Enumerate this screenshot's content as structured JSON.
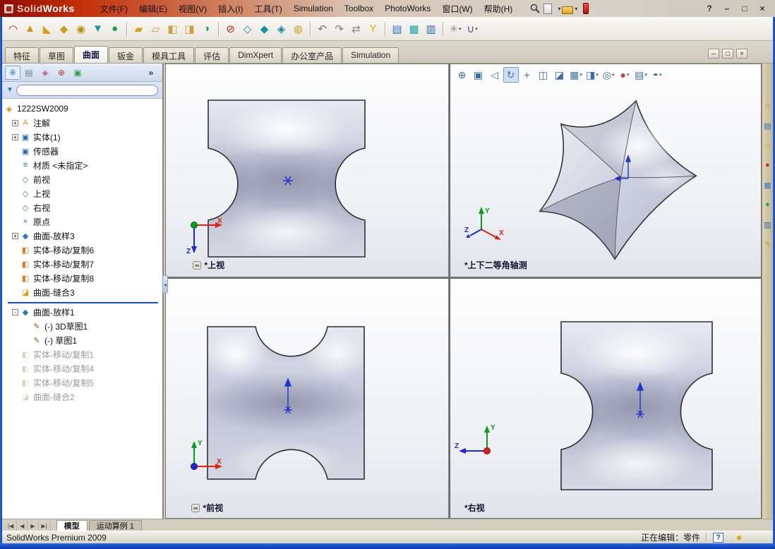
{
  "titlebar": {
    "brand": {
      "part1": "Solid",
      "part2": "Works"
    },
    "menus": [
      {
        "n": "menu-file",
        "lab": "文件(F)"
      },
      {
        "n": "menu-edit",
        "lab": "编辑(E)"
      },
      {
        "n": "menu-view",
        "lab": "视图(V)"
      },
      {
        "n": "menu-insert",
        "lab": "插入(I)"
      },
      {
        "n": "menu-tools",
        "lab": "工具(T)"
      },
      {
        "n": "menu-simulation",
        "lab": "Simulation"
      },
      {
        "n": "menu-toolbox",
        "lab": "Toolbox"
      },
      {
        "n": "menu-photoworks",
        "lab": "PhotoWorks"
      },
      {
        "n": "menu-window",
        "lab": "窗口(W)"
      },
      {
        "n": "menu-help",
        "lab": "帮助(H)"
      }
    ],
    "quick_caret": "▾",
    "window_controls": [
      {
        "n": "help-button",
        "g": "?"
      },
      {
        "n": "minimize-button",
        "g": "–"
      },
      {
        "n": "restore-button",
        "g": "□"
      },
      {
        "n": "close-button",
        "g": "×"
      }
    ]
  },
  "toolbar": {
    "icons": [
      {
        "n": "swept-surface-icon",
        "g": "◠",
        "ist": "color:#c43010"
      },
      {
        "n": "extruded-surface-icon",
        "g": "▲",
        "ist": "color:#d89010"
      },
      {
        "n": "revolved-surface-icon",
        "g": "◣",
        "ist": "color:#d8a010"
      },
      {
        "n": "lofted-surface-icon",
        "g": "◆",
        "ist": "color:#c8a020"
      },
      {
        "n": "boundary-surface-icon",
        "g": "◉",
        "ist": "color:#b89010"
      },
      {
        "n": "offset-surface-icon",
        "g": "▼",
        "ist": "color:#1898a0"
      },
      {
        "n": "radiate-surface-icon",
        "g": "●",
        "ist": "color:#18a048"
      },
      {
        "n": "toolbar-separator",
        "cls": "tbi tsep",
        "it": "false"
      },
      {
        "n": "filled-surface-icon",
        "g": "▰",
        "ist": "color:#d4a017"
      },
      {
        "n": "planar-surface-icon",
        "g": "▱",
        "ist": "color:#c8a040"
      },
      {
        "n": "extend-surface-icon",
        "g": "◧",
        "ist": "color:#caa040"
      },
      {
        "n": "trim-surface-icon",
        "g": "◨",
        "ist": "color:#caa040"
      },
      {
        "n": "knit-surface-icon",
        "g": "◑",
        "ist": "color:#20a060"
      },
      {
        "n": "toolbar-separator",
        "cls": "tbi tsep",
        "it": "false"
      },
      {
        "n": "delete-face-icon",
        "g": "⊘",
        "ist": "color:#c02020"
      },
      {
        "n": "replace-face-icon",
        "g": "◇",
        "ist": "color:#1890a8"
      },
      {
        "n": "untrim-surface-icon",
        "g": "◆",
        "ist": "color:#1890a8"
      },
      {
        "n": "thicken-icon",
        "g": "◈",
        "ist": "color:#16889c"
      },
      {
        "n": "freeform-icon",
        "g": "◍",
        "ist": "color:#d0a018"
      },
      {
        "n": "toolbar-separator",
        "cls": "tbi tsep",
        "it": "false"
      },
      {
        "n": "undo-icon",
        "g": "↶",
        "ist": "color:#787878"
      },
      {
        "n": "redo-icon",
        "g": "↷",
        "ist": "color:#787878"
      },
      {
        "n": "rebuild-icon",
        "g": "⇄",
        "ist": "color:#888888"
      },
      {
        "n": "mirror-icon",
        "g": "Y",
        "ist": "color:#d4b000"
      },
      {
        "n": "toolbar-separator",
        "cls": "tbi tsep",
        "it": "false"
      },
      {
        "n": "reference-geometry-icon",
        "g": "▤",
        "ist": "color:#3070c0"
      },
      {
        "n": "curves-icon",
        "g": "▦",
        "ist": "color:#18a0a8"
      },
      {
        "n": "instant3d-icon",
        "g": "▥",
        "ist": "color:#2868b8"
      },
      {
        "n": "toolbar-separator",
        "cls": "tbi tsep",
        "it": "false"
      },
      {
        "n": "sketch-tools-icon",
        "g": "✳",
        "ist": "color:#9090a0",
        "c": "▾"
      },
      {
        "n": "spline-tools-icon",
        "g": "∪",
        "ist": "color:#7040a0",
        "c": "▾"
      }
    ]
  },
  "commandmanager": {
    "tabs": [
      {
        "n": "tab-features",
        "lab": "特征"
      },
      {
        "n": "tab-sketch",
        "lab": "草图"
      },
      {
        "n": "tab-surfaces",
        "lab": "曲面",
        "cls": "ctab active"
      },
      {
        "n": "tab-sheet-metal",
        "lab": "钣金"
      },
      {
        "n": "tab-mold-tools",
        "lab": "模具工具"
      },
      {
        "n": "tab-evaluate",
        "lab": "评估"
      },
      {
        "n": "tab-dimxpert",
        "lab": "DimXpert"
      },
      {
        "n": "tab-office-products",
        "lab": "办公室产品"
      },
      {
        "n": "tab-simulation",
        "lab": "Simulation"
      }
    ],
    "pane_controls": [
      {
        "n": "doc-minimize-button",
        "g": "–"
      },
      {
        "n": "doc-restore-button",
        "g": "□"
      },
      {
        "n": "doc-close-button",
        "g": "×"
      }
    ]
  },
  "panel": {
    "manager_tabs": [
      {
        "n": "featuremanager-tab-icon",
        "g": "※",
        "ist": "color:#2878c8",
        "cls": "mti active"
      },
      {
        "n": "propertymanager-tab-icon",
        "g": "▤",
        "ist": "color:#708090"
      },
      {
        "n": "configurationmanager-tab-icon",
        "g": "◈",
        "ist": "color:#c05890"
      },
      {
        "n": "dimxpertmanager-tab-icon",
        "g": "⊕",
        "ist": "color:#c03030"
      },
      {
        "n": "displaymanager-tab-icon",
        "g": "▣",
        "ist": "color:#30a050"
      },
      {
        "n": "panel-overflow-icon",
        "g": "»",
        "cls": "mti overflow"
      }
    ],
    "filter_glyph": "▼"
  },
  "tree": {
    "items": [
      {
        "n": "tree-root-part",
        "cls": "trow root",
        "g": "◈",
        "ist": "color:#c89010",
        "lab": "1222SW2009"
      },
      {
        "n": "tree-item-annotations",
        "exp": "+",
        "g": "A",
        "ist": "color:#c8980c",
        "lab": "注解"
      },
      {
        "n": "tree-item-solid-bodies",
        "exp": "+",
        "g": "▣",
        "ist": "color:#2468b0",
        "lab": "实体(1)"
      },
      {
        "n": "tree-item-sensors",
        "g": "▣",
        "ist": "color:#2468b0",
        "lab": "传感器"
      },
      {
        "n": "tree-item-material",
        "g": "≡",
        "ist": "color:#3060c0",
        "lab": "材质 <未指定>"
      },
      {
        "n": "tree-item-front-plane",
        "g": "◇",
        "ist": "color:#3878b8",
        "lab": "前视"
      },
      {
        "n": "tree-item-top-plane",
        "g": "◇",
        "ist": "color:#3878b8",
        "lab": "上视"
      },
      {
        "n": "tree-item-right-plane",
        "g": "◇",
        "ist": "color:#3878b8",
        "lab": "右视"
      },
      {
        "n": "tree-item-origin",
        "g": "⌖",
        "ist": "color:#3878b8",
        "lab": "原点"
      },
      {
        "n": "tree-item-surface-loft3",
        "exp": "+",
        "g": "◆",
        "ist": "color:#2878c0",
        "lab": "曲面-放样3"
      },
      {
        "n": "tree-item-body-move-copy6",
        "g": "◧",
        "ist": "color:#e07820",
        "lab": "实体-移动/复制6"
      },
      {
        "n": "tree-item-body-move-copy7",
        "g": "◧",
        "ist": "color:#e07820",
        "lab": "实体-移动/复制7"
      },
      {
        "n": "tree-item-body-move-copy8",
        "g": "◧",
        "ist": "color:#e07820",
        "lab": "实体-移动/复制8"
      },
      {
        "n": "tree-item-surface-knit3",
        "g": "◪",
        "ist": "color:#d8a010",
        "lab": "曲面-缝合3"
      },
      {
        "n": "rollback-bar",
        "cls": "trow rollback"
      },
      {
        "n": "tree-item-surface-loft1",
        "exp": "-",
        "g": "◆",
        "ist": "color:#2878c0",
        "lab": "曲面-放样1"
      },
      {
        "n": "tree-item-3d-sketch1",
        "st": "padding-left:30px",
        "g": "✎",
        "ist": "color:#806020",
        "lab": "(-) 3D草图1"
      },
      {
        "n": "tree-item-sketch1",
        "st": "padding-left:30px",
        "g": "✎",
        "ist": "color:#806020",
        "lab": "(-) 草图1"
      },
      {
        "n": "tree-item-body-move-copy1",
        "cls": "trow gray",
        "g": "◧",
        "ist": "color:#c0a888",
        "lab": "实体-移动/复制1"
      },
      {
        "n": "tree-item-body-move-copy4",
        "cls": "trow gray",
        "g": "◧",
        "ist": "color:#c0a888",
        "lab": "实体-移动/复制4"
      },
      {
        "n": "tree-item-body-move-copy5",
        "cls": "trow gray",
        "g": "◧",
        "ist": "color:#c0a888",
        "lab": "实体-移动/复制5"
      },
      {
        "n": "tree-item-surface-knit2",
        "cls": "trow gray",
        "g": "◪",
        "ist": "color:#c4b488",
        "lab": "曲面-缝合2"
      }
    ]
  },
  "graphics": {
    "splitter_glyph": "◂"
  },
  "headsup": {
    "icons": [
      {
        "n": "zoom-to-fit-icon",
        "g": "⊕"
      },
      {
        "n": "zoom-to-area-icon",
        "g": "▣"
      },
      {
        "n": "previous-view-icon",
        "g": "◁"
      },
      {
        "n": "rotate-view-icon",
        "g": "↻",
        "cls": "hui active"
      },
      {
        "n": "pan-icon",
        "g": "+"
      },
      {
        "n": "3d-drawing-view-icon",
        "g": "◫"
      },
      {
        "n": "section-view-icon",
        "g": "◪"
      },
      {
        "n": "view-orientation-icon",
        "g": "▦",
        "c": "▾"
      },
      {
        "n": "display-style-icon",
        "g": "◨",
        "c": "▾"
      },
      {
        "n": "hide-show-items-icon",
        "g": "◎",
        "c": "▾"
      },
      {
        "n": "edit-appearance-icon",
        "g": "●",
        "ist": "color:#c84040",
        "c": "▾"
      },
      {
        "n": "apply-scene-icon",
        "g": "▤",
        "c": "▾"
      },
      {
        "n": "view-settings-icon",
        "g": "◓",
        "c": "▾"
      }
    ]
  },
  "viewports": {
    "top": {
      "label": "*上视",
      "icon": "∞"
    },
    "iso": {
      "label": "*上下二等角轴测"
    },
    "front": {
      "label": "*前视",
      "icon": "∞"
    },
    "right": {
      "label": "*右视"
    }
  },
  "taskpane": {
    "icons": [
      {
        "n": "solidworks-resources-icon",
        "g": "⌂",
        "ist": "color:#c87818"
      },
      {
        "n": "design-library-icon",
        "g": "▤",
        "ist": "color:#2868b8"
      },
      {
        "n": "file-explorer-icon",
        "g": "▱",
        "ist": "color:#e0a818"
      },
      {
        "n": "solidworks-search-icon",
        "g": "●",
        "ist": "color:#c03030"
      },
      {
        "n": "view-palette-icon",
        "g": "▦",
        "ist": "color:#3878c8"
      },
      {
        "n": "appearances-icon",
        "g": "●",
        "ist": "color:#28a048"
      },
      {
        "n": "custom-properties-icon",
        "g": "▥",
        "ist": "color:#3060a0"
      },
      {
        "n": "document-recovery-icon",
        "g": "✎",
        "ist": "color:#c8a018"
      }
    ]
  },
  "bottombar": {
    "nav": [
      {
        "n": "scroll-first-icon",
        "g": "|◀"
      },
      {
        "n": "scroll-prev-icon",
        "g": "◀"
      },
      {
        "n": "scroll-next-icon",
        "g": "▶"
      },
      {
        "n": "scroll-last-icon",
        "g": "▶|"
      }
    ],
    "tabs": [
      {
        "n": "tab-model",
        "lab": "模型",
        "cls": "btab active"
      },
      {
        "n": "tab-motion-study-1",
        "lab": "运动算例 1"
      }
    ]
  },
  "statusbar": {
    "product": "SolidWorks Premium 2009",
    "editing_status": "正在编辑：零件",
    "help": "?"
  }
}
